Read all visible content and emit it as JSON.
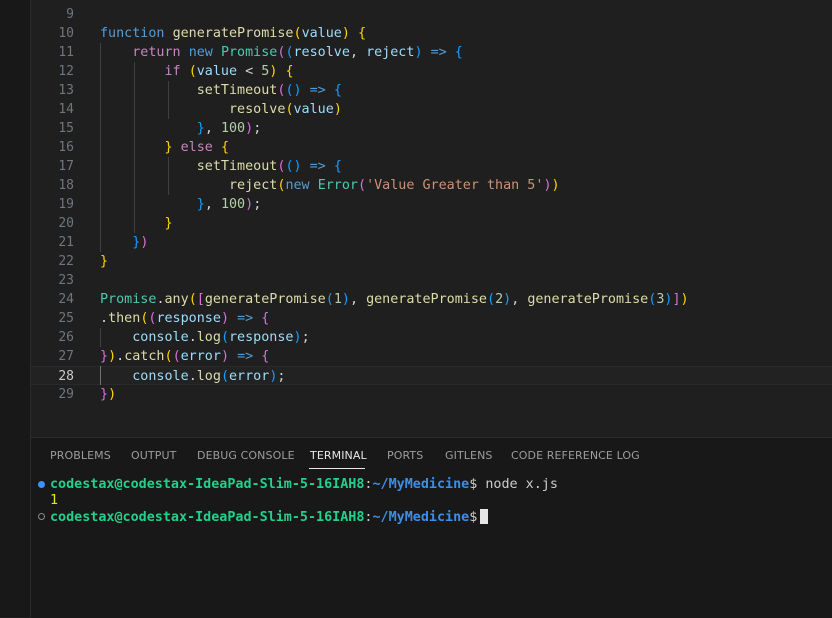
{
  "editor": {
    "active_line": "28",
    "lines": [
      {
        "n": "9",
        "tokens": []
      },
      {
        "n": "10",
        "tokens": [
          {
            "c": "k",
            "t": "function"
          },
          {
            "c": "",
            "t": " "
          },
          {
            "c": "f",
            "t": "generatePromise"
          },
          {
            "c": "b1",
            "t": "("
          },
          {
            "c": "v",
            "t": "value"
          },
          {
            "c": "b1",
            "t": ")"
          },
          {
            "c": "",
            "t": " "
          },
          {
            "c": "b1",
            "t": "{"
          }
        ]
      },
      {
        "n": "11",
        "tokens": [
          {
            "c": "",
            "t": "    "
          },
          {
            "c": "kc",
            "t": "return"
          },
          {
            "c": "",
            "t": " "
          },
          {
            "c": "k",
            "t": "new"
          },
          {
            "c": "",
            "t": " "
          },
          {
            "c": "c",
            "t": "Promise"
          },
          {
            "c": "b2",
            "t": "("
          },
          {
            "c": "b3",
            "t": "("
          },
          {
            "c": "v",
            "t": "resolve"
          },
          {
            "c": "",
            "t": ", "
          },
          {
            "c": "v",
            "t": "reject"
          },
          {
            "c": "b3",
            "t": ")"
          },
          {
            "c": "",
            "t": " "
          },
          {
            "c": "k",
            "t": "=>"
          },
          {
            "c": "",
            "t": " "
          },
          {
            "c": "b3",
            "t": "{"
          }
        ]
      },
      {
        "n": "12",
        "tokens": [
          {
            "c": "",
            "t": "        "
          },
          {
            "c": "kc",
            "t": "if"
          },
          {
            "c": "",
            "t": " "
          },
          {
            "c": "b1",
            "t": "("
          },
          {
            "c": "v",
            "t": "value"
          },
          {
            "c": "",
            "t": " < "
          },
          {
            "c": "n",
            "t": "5"
          },
          {
            "c": "b1",
            "t": ")"
          },
          {
            "c": "",
            "t": " "
          },
          {
            "c": "b1",
            "t": "{"
          }
        ]
      },
      {
        "n": "13",
        "tokens": [
          {
            "c": "",
            "t": "            "
          },
          {
            "c": "f",
            "t": "setTimeout"
          },
          {
            "c": "b2",
            "t": "("
          },
          {
            "c": "b3",
            "t": "()"
          },
          {
            "c": "",
            "t": " "
          },
          {
            "c": "k",
            "t": "=>"
          },
          {
            "c": "",
            "t": " "
          },
          {
            "c": "b3",
            "t": "{"
          }
        ]
      },
      {
        "n": "14",
        "tokens": [
          {
            "c": "",
            "t": "                "
          },
          {
            "c": "f",
            "t": "resolve"
          },
          {
            "c": "b1",
            "t": "("
          },
          {
            "c": "v",
            "t": "value"
          },
          {
            "c": "b1",
            "t": ")"
          }
        ]
      },
      {
        "n": "15",
        "tokens": [
          {
            "c": "",
            "t": "            "
          },
          {
            "c": "b3",
            "t": "}"
          },
          {
            "c": "",
            "t": ", "
          },
          {
            "c": "n",
            "t": "100"
          },
          {
            "c": "b2",
            "t": ")"
          },
          {
            "c": "",
            "t": ";"
          }
        ]
      },
      {
        "n": "16",
        "tokens": [
          {
            "c": "",
            "t": "        "
          },
          {
            "c": "b1",
            "t": "}"
          },
          {
            "c": "",
            "t": " "
          },
          {
            "c": "kc",
            "t": "else"
          },
          {
            "c": "",
            "t": " "
          },
          {
            "c": "b1",
            "t": "{"
          }
        ]
      },
      {
        "n": "17",
        "tokens": [
          {
            "c": "",
            "t": "            "
          },
          {
            "c": "f",
            "t": "setTimeout"
          },
          {
            "c": "b2",
            "t": "("
          },
          {
            "c": "b3",
            "t": "()"
          },
          {
            "c": "",
            "t": " "
          },
          {
            "c": "k",
            "t": "=>"
          },
          {
            "c": "",
            "t": " "
          },
          {
            "c": "b3",
            "t": "{"
          }
        ]
      },
      {
        "n": "18",
        "tokens": [
          {
            "c": "",
            "t": "                "
          },
          {
            "c": "f",
            "t": "reject"
          },
          {
            "c": "b1",
            "t": "("
          },
          {
            "c": "k",
            "t": "new"
          },
          {
            "c": "",
            "t": " "
          },
          {
            "c": "c",
            "t": "Error"
          },
          {
            "c": "b2",
            "t": "("
          },
          {
            "c": "s",
            "t": "'Value Greater than 5'"
          },
          {
            "c": "b2",
            "t": ")"
          },
          {
            "c": "b1",
            "t": ")"
          }
        ]
      },
      {
        "n": "19",
        "tokens": [
          {
            "c": "",
            "t": "            "
          },
          {
            "c": "b3",
            "t": "}"
          },
          {
            "c": "",
            "t": ", "
          },
          {
            "c": "n",
            "t": "100"
          },
          {
            "c": "b2",
            "t": ")"
          },
          {
            "c": "",
            "t": ";"
          }
        ]
      },
      {
        "n": "20",
        "tokens": [
          {
            "c": "",
            "t": "        "
          },
          {
            "c": "b1",
            "t": "}"
          }
        ]
      },
      {
        "n": "21",
        "tokens": [
          {
            "c": "",
            "t": "    "
          },
          {
            "c": "b3",
            "t": "}"
          },
          {
            "c": "b2",
            "t": ")"
          }
        ]
      },
      {
        "n": "22",
        "tokens": [
          {
            "c": "b1",
            "t": "}"
          }
        ]
      },
      {
        "n": "23",
        "tokens": []
      },
      {
        "n": "24",
        "tokens": [
          {
            "c": "c",
            "t": "Promise"
          },
          {
            "c": "",
            "t": "."
          },
          {
            "c": "f",
            "t": "any"
          },
          {
            "c": "b1",
            "t": "("
          },
          {
            "c": "b2",
            "t": "["
          },
          {
            "c": "f",
            "t": "generatePromise"
          },
          {
            "c": "b3",
            "t": "("
          },
          {
            "c": "n",
            "t": "1"
          },
          {
            "c": "b3",
            "t": ")"
          },
          {
            "c": "",
            "t": ", "
          },
          {
            "c": "f",
            "t": "generatePromise"
          },
          {
            "c": "b3",
            "t": "("
          },
          {
            "c": "n",
            "t": "2"
          },
          {
            "c": "b3",
            "t": ")"
          },
          {
            "c": "",
            "t": ", "
          },
          {
            "c": "f",
            "t": "generatePromise"
          },
          {
            "c": "b3",
            "t": "("
          },
          {
            "c": "n",
            "t": "3"
          },
          {
            "c": "b3",
            "t": ")"
          },
          {
            "c": "b2",
            "t": "]"
          },
          {
            "c": "b1",
            "t": ")"
          }
        ]
      },
      {
        "n": "25",
        "tokens": [
          {
            "c": "",
            "t": "."
          },
          {
            "c": "f",
            "t": "then"
          },
          {
            "c": "b1",
            "t": "("
          },
          {
            "c": "b2",
            "t": "("
          },
          {
            "c": "v",
            "t": "response"
          },
          {
            "c": "b2",
            "t": ")"
          },
          {
            "c": "",
            "t": " "
          },
          {
            "c": "k",
            "t": "=>"
          },
          {
            "c": "",
            "t": " "
          },
          {
            "c": "b2",
            "t": "{"
          }
        ]
      },
      {
        "n": "26",
        "tokens": [
          {
            "c": "",
            "t": "    "
          },
          {
            "c": "v",
            "t": "console"
          },
          {
            "c": "",
            "t": "."
          },
          {
            "c": "f",
            "t": "log"
          },
          {
            "c": "b3",
            "t": "("
          },
          {
            "c": "v",
            "t": "response"
          },
          {
            "c": "b3",
            "t": ")"
          },
          {
            "c": "",
            "t": ";"
          }
        ]
      },
      {
        "n": "27",
        "tokens": [
          {
            "c": "b2",
            "t": "}"
          },
          {
            "c": "b1",
            "t": ")"
          },
          {
            "c": "",
            "t": "."
          },
          {
            "c": "f",
            "t": "catch"
          },
          {
            "c": "b1",
            "t": "("
          },
          {
            "c": "b2",
            "t": "("
          },
          {
            "c": "v",
            "t": "error"
          },
          {
            "c": "b2",
            "t": ")"
          },
          {
            "c": "",
            "t": " "
          },
          {
            "c": "k",
            "t": "=>"
          },
          {
            "c": "",
            "t": " "
          },
          {
            "c": "b2",
            "t": "{"
          }
        ]
      },
      {
        "n": "28",
        "tokens": [
          {
            "c": "",
            "t": "    "
          },
          {
            "c": "v",
            "t": "console"
          },
          {
            "c": "",
            "t": "."
          },
          {
            "c": "f",
            "t": "log"
          },
          {
            "c": "b3",
            "t": "("
          },
          {
            "c": "v",
            "t": "error"
          },
          {
            "c": "b3",
            "t": ")"
          },
          {
            "c": "",
            "t": ";"
          }
        ]
      },
      {
        "n": "29",
        "tokens": [
          {
            "c": "b2",
            "t": "}"
          },
          {
            "c": "b1",
            "t": ")"
          }
        ]
      }
    ]
  },
  "panel": {
    "tabs": [
      "PROBLEMS",
      "OUTPUT",
      "DEBUG CONSOLE",
      "TERMINAL",
      "PORTS",
      "GITLENS",
      "CODE REFERENCE LOG"
    ],
    "active_tab": "TERMINAL"
  },
  "terminal": {
    "userhost": "codestax@codestax-IdeaPad-Slim-5-16IAH8",
    "colon": ":",
    "path": "~/MyMedicine",
    "prompt": "$",
    "command": "node x.js",
    "output": "1"
  },
  "colors": {
    "accent": "#3794ff",
    "prompt_user": "#23d18b",
    "prompt_path": "#3b8eea",
    "output": "#e5e510"
  }
}
